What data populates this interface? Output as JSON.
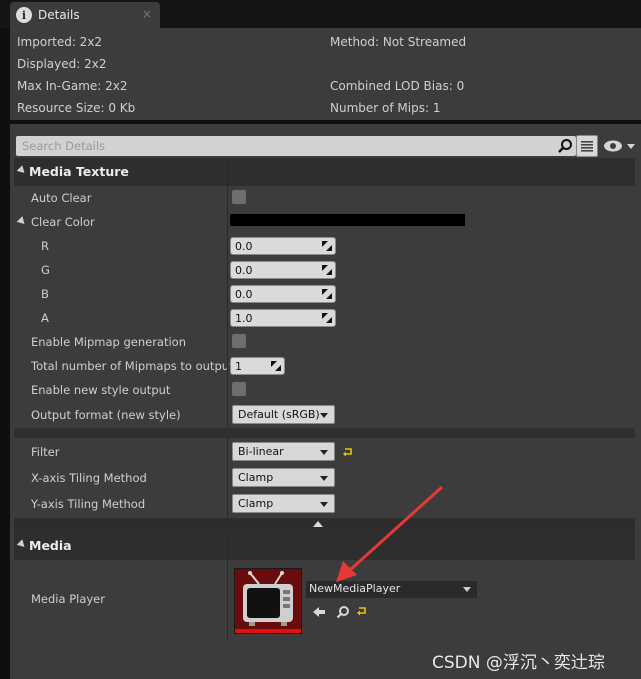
{
  "tab": {
    "title": "Details",
    "icon": "info-icon",
    "close": "×"
  },
  "info": {
    "imported": "Imported: 2x2",
    "displayed": "Displayed: 2x2",
    "max_in_game": "Max In-Game: 2x2",
    "resource_size": "Resource Size: 0 Kb",
    "method": "Method: Not Streamed",
    "combined_lod_bias": "Combined LOD Bias: 0",
    "number_of_mips": "Number of Mips: 1"
  },
  "search": {
    "placeholder": "Search Details"
  },
  "media_texture": {
    "title": "Media Texture",
    "auto_clear": "Auto Clear",
    "clear_color": "Clear Color",
    "r_label": "R",
    "r_value": "0.0",
    "g_label": "G",
    "g_value": "0.0",
    "b_label": "B",
    "b_value": "0.0",
    "a_label": "A",
    "a_value": "1.0",
    "enable_mipmap": "Enable Mipmap generation",
    "total_mipmaps": "Total number of Mipmaps to output",
    "total_mipmaps_value": "1",
    "enable_new_style": "Enable new style output",
    "output_format": "Output format (new style)",
    "output_format_value": "Default (sRGB)"
  },
  "filter": {
    "filter_label": "Filter",
    "filter_value": "Bi-linear",
    "x_tiling_label": "X-axis Tiling Method",
    "x_tiling_value": "Clamp",
    "y_tiling_label": "Y-axis Tiling Method",
    "y_tiling_value": "Clamp"
  },
  "media": {
    "title": "Media",
    "media_player_label": "Media Player",
    "media_player_value": "NewMediaPlayer"
  },
  "colors": {
    "panel": "#3c3c3c",
    "category": "#2e2e2e",
    "accent_red": "#e53935",
    "reset_yellow": "#e8c400"
  },
  "watermark": "CSDN @浮沉丶奕辻琮"
}
